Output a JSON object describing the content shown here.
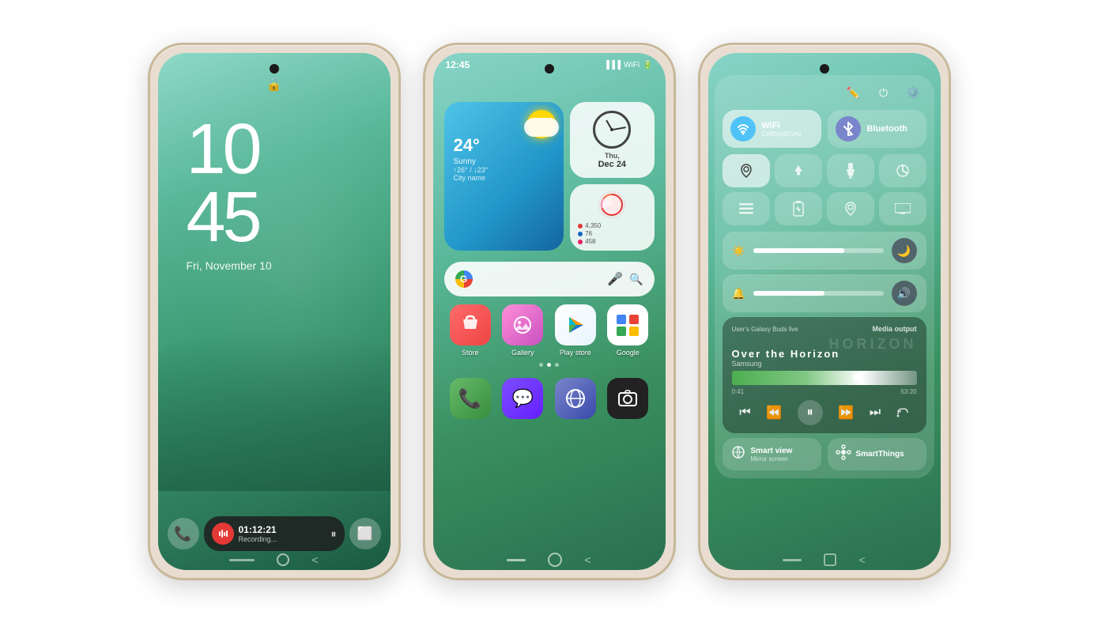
{
  "phones": {
    "phone1": {
      "screen": "lock",
      "time": {
        "hour": "10",
        "minute": "45"
      },
      "date": "Fri, November 10",
      "lock_icon": "🔒",
      "recording": {
        "time": "01:12:21",
        "label": "Recording..."
      }
    },
    "phone2": {
      "screen": "home",
      "status_time": "12:45",
      "weather": {
        "temp": "24°",
        "description": "Sunny",
        "range": "↑26° / ↓23°",
        "city": "City name"
      },
      "clock": {
        "day": "Thu,",
        "date": "Dec 24"
      },
      "health": {
        "stats": [
          {
            "color": "red",
            "value": "4,350"
          },
          {
            "color": "blue",
            "value": "76"
          },
          {
            "color": "pink",
            "value": "458"
          }
        ]
      },
      "apps": [
        {
          "label": "Store",
          "icon": "store"
        },
        {
          "label": "Gallery",
          "icon": "gallery"
        },
        {
          "label": "Play store",
          "icon": "play"
        },
        {
          "label": "Google",
          "icon": "google"
        }
      ],
      "apps2": [
        {
          "label": "Phone",
          "icon": "phone"
        },
        {
          "label": "Messages",
          "icon": "messages"
        },
        {
          "label": "Internet",
          "icon": "internet"
        },
        {
          "label": "Camera",
          "icon": "camera"
        }
      ]
    },
    "phone3": {
      "screen": "control",
      "wifi": {
        "label": "WiFi",
        "sub": "CellEpot5GHz",
        "active": true
      },
      "bluetooth": {
        "label": "Bluetooth",
        "active": false
      },
      "media": {
        "device": "User's Galaxy Buds live",
        "output": "Media output",
        "title": "HORIZON",
        "title_display": "Over the Horizon",
        "artist": "Samsung",
        "time_start": "0:41",
        "time_end": "53:20"
      },
      "smart_view": {
        "label": "Smart view",
        "sub": "Mirror screen"
      },
      "smart_things": {
        "label": "SmartThings"
      }
    }
  }
}
